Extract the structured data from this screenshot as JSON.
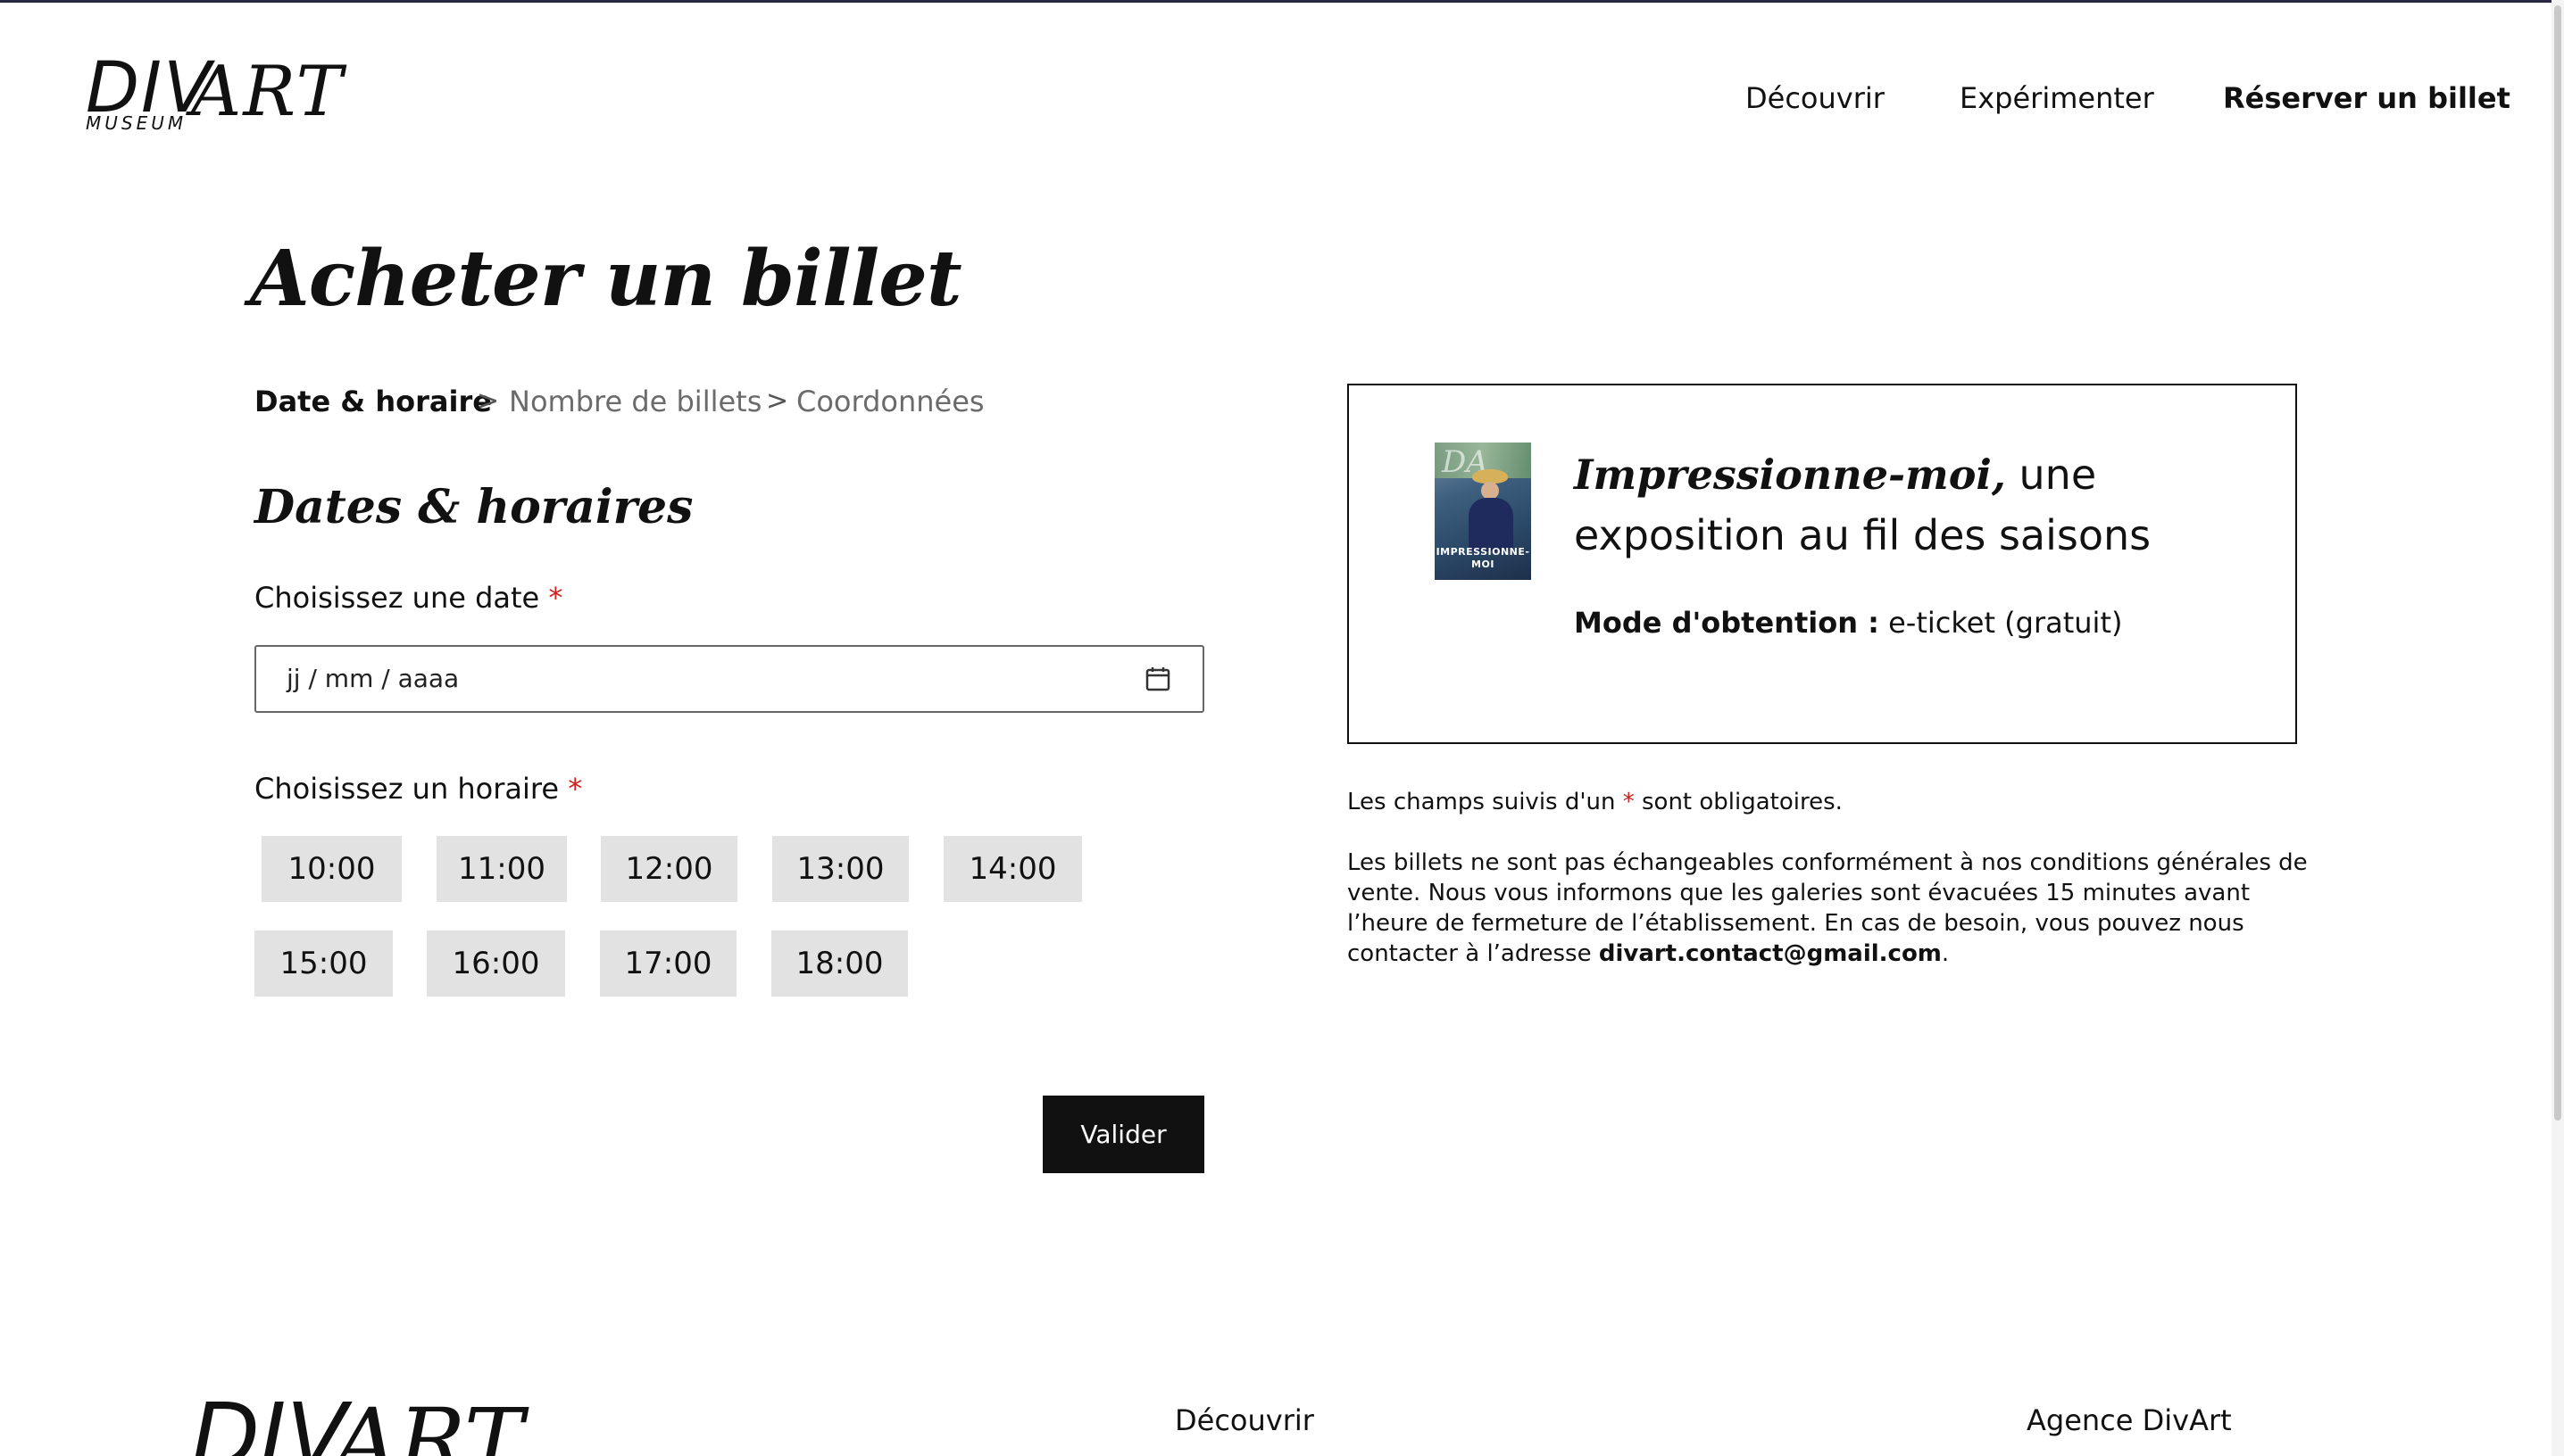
{
  "header": {
    "logo": {
      "div": "DIV",
      "art": "ART",
      "museum": "MUSEUM"
    },
    "nav": [
      "Découvrir",
      "Expérimenter",
      "Réserver un billet"
    ]
  },
  "main": {
    "title": "Acheter un billet",
    "breadcrumb": [
      "Date & horaire",
      "Nombre de billets",
      "Coordonnées"
    ],
    "breadcrumb_separator": ">",
    "section_title": "Dates & horaires",
    "date_label": "Choisissez une date",
    "required_mark": "*",
    "date_placeholder": "jj / mm / aaaa",
    "time_label": "Choisissez un horaire",
    "time_slots": [
      "10:00",
      "11:00",
      "12:00",
      "13:00",
      "14:00",
      "15:00",
      "16:00",
      "17:00",
      "18:00"
    ],
    "submit_label": "Valider"
  },
  "card": {
    "thumbnail_caption": "IMPRESSIONNE-MOI",
    "title_emphasis": "Impressionne-moi,",
    "title_rest": " une exposition au fil des saisons",
    "mode_key": "Mode d'obtention :",
    "mode_value": " e-ticket (gratuit)"
  },
  "notes": {
    "required_prefix": "Les champs suivis d'un ",
    "required_mark": "*",
    "required_suffix": " sont obligatoires.",
    "info": "Les billets ne sont pas échangeables conformément à nos conditions générales de vente. Nous vous informons que les galeries sont évacuées 15 minutes avant l’heure de fermeture de l’établissement. En cas de besoin, vous pouvez nous contacter à l’adresse ",
    "email": "divart.contact@gmail.com",
    "end": "."
  },
  "footer": {
    "logo": {
      "div": "DIV",
      "art": "ART"
    },
    "links": [
      "Découvrir",
      "Agence DivArt"
    ]
  },
  "colors": {
    "accent": "#d21f1f",
    "button": "#111111",
    "slot_bg": "#e2e2e2"
  }
}
